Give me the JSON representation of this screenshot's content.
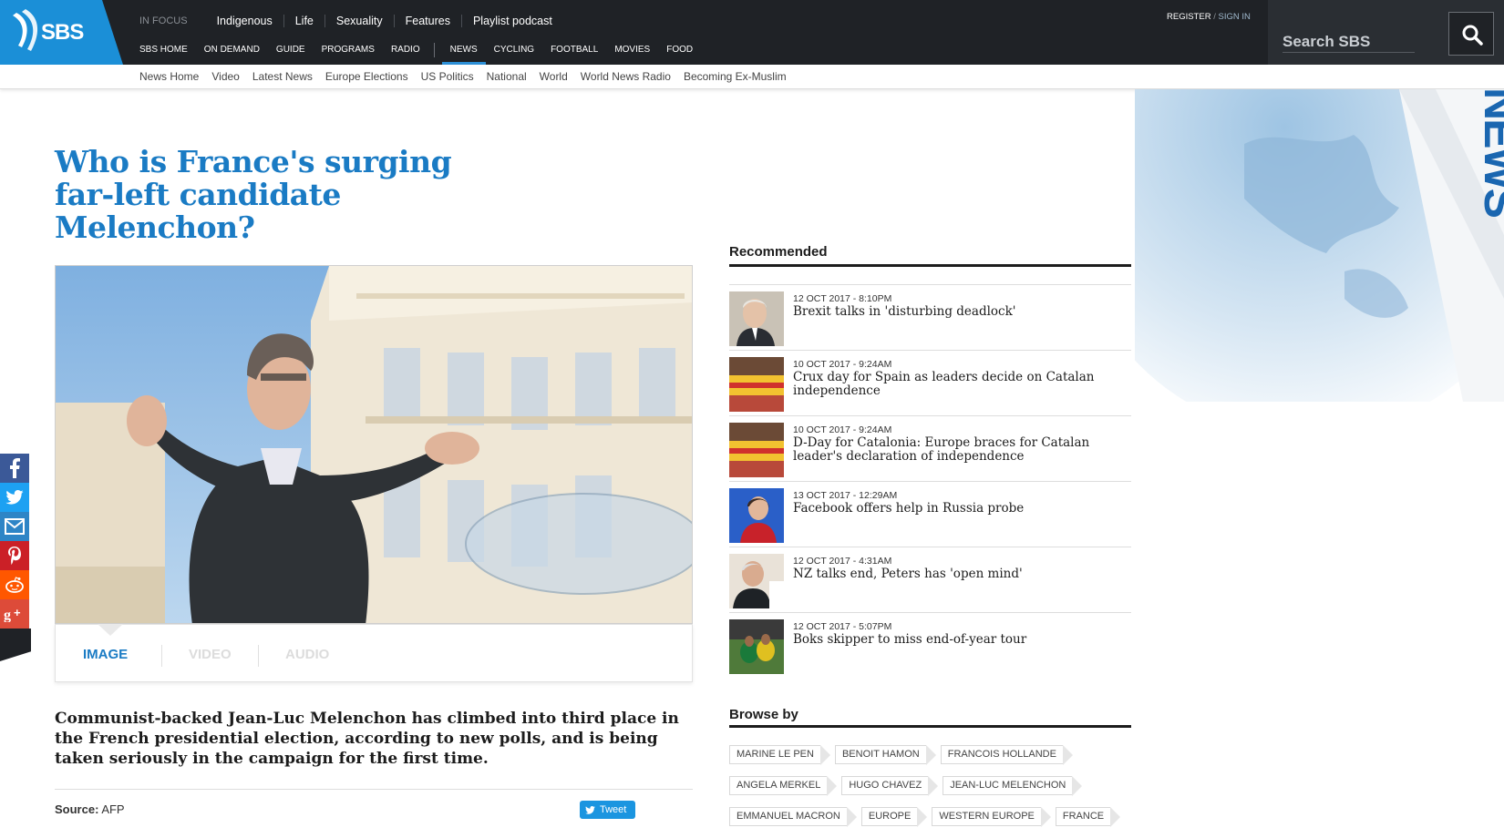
{
  "brand": {
    "logo_text": "SBS",
    "accent": "#1a7bc4",
    "header_bg": "#1f2226"
  },
  "nav_top": {
    "in_focus": "IN FOCUS",
    "items": [
      "Indigenous",
      "Life",
      "Sexuality",
      "Features",
      "Playlist podcast"
    ]
  },
  "nav_main": {
    "items": [
      "SBS HOME",
      "ON DEMAND",
      "GUIDE",
      "PROGRAMS",
      "RADIO",
      "NEWS",
      "CYCLING",
      "FOOTBALL",
      "MOVIES",
      "FOOD"
    ],
    "active": "NEWS"
  },
  "auth": {
    "register": "REGISTER",
    "slash": " / ",
    "signin": "SIGN IN"
  },
  "search": {
    "placeholder": "Search SBS"
  },
  "subnav": [
    "News Home",
    "Video",
    "Latest News",
    "Europe Elections",
    "US Politics",
    "National",
    "World",
    "World News Radio",
    "Becoming Ex-Muslim"
  ],
  "decoration": {
    "news_text": "NEWS"
  },
  "article": {
    "title": "Who is France's surging far-left candidate Melenchon?",
    "media_tabs": [
      "IMAGE",
      "VIDEO",
      "AUDIO"
    ],
    "active_tab": "IMAGE",
    "lede": "Communist-backed Jean-Luc Melenchon has climbed into third place in the French presidential election, according to new polls, and is being taken seriously in the campaign for the first time.",
    "source_label": "Source:",
    "source": "AFP",
    "tweet": "Tweet"
  },
  "share": [
    "facebook-icon",
    "twitter-icon",
    "email-icon",
    "pinterest-icon",
    "reddit-icon",
    "googleplus-icon"
  ],
  "recommended": {
    "title": "Recommended",
    "items": [
      {
        "date": "12 OCT 2017 - 8:10PM",
        "headline": "Brexit talks in 'disturbing deadlock'"
      },
      {
        "date": "10 OCT 2017 - 9:24AM",
        "headline": "Crux day for Spain as leaders decide on Catalan independence"
      },
      {
        "date": "10 OCT 2017 - 9:24AM",
        "headline": "D-Day for Catalonia: Europe braces for Catalan leader's declaration of independence"
      },
      {
        "date": "13 OCT 2017 - 12:29AM",
        "headline": "Facebook offers help in Russia probe"
      },
      {
        "date": "12 OCT 2017 - 4:31AM",
        "headline": "NZ talks end, Peters has 'open mind'"
      },
      {
        "date": "12 OCT 2017 - 5:07PM",
        "headline": "Boks skipper to miss end-of-year tour"
      }
    ]
  },
  "browse": {
    "title": "Browse by",
    "rows": [
      [
        "MARINE LE PEN",
        "BENOIT HAMON",
        "FRANCOIS HOLLANDE"
      ],
      [
        "ANGELA MERKEL",
        "HUGO CHAVEZ",
        "JEAN-LUC MELENCHON"
      ],
      [
        "EMMANUEL MACRON",
        "EUROPE",
        "WESTERN EUROPE",
        "FRANCE"
      ]
    ]
  }
}
